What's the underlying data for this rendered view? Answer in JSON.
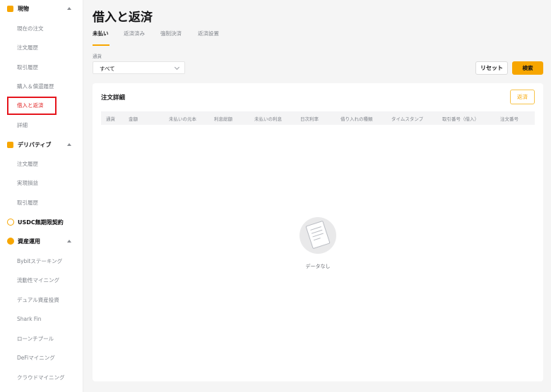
{
  "sidebar": {
    "sections": [
      {
        "label": "現物",
        "items": [
          "現在の注文",
          "注文履歴",
          "取引履歴",
          "購入＆償還履歴",
          "借入と返済",
          "詳細"
        ]
      },
      {
        "label": "デリバティブ",
        "items": [
          "注文履歴",
          "実現損益",
          "取引履歴"
        ]
      },
      {
        "label": "USDC無期限契約",
        "items": []
      },
      {
        "label": "資産運用",
        "items": [
          "Bybitステーキング",
          "流動性マイニング",
          "デュアル資産投資",
          "Shark Fin",
          "ローンチプール",
          "DeFiマイニング",
          "クラウドマイニング"
        ]
      }
    ],
    "active_item": "借入と返済"
  },
  "main": {
    "title": "借入と返済",
    "tabs": [
      "未払い",
      "返済済み",
      "強制決済",
      "返済設置"
    ],
    "active_tab": "未払い",
    "filter": {
      "currency_label": "通貨",
      "currency_value": "すべて"
    },
    "buttons": {
      "reset": "リセット",
      "search": "検索",
      "repay": "返済"
    },
    "card": {
      "title": "注文詳細",
      "columns": [
        "通貨",
        "金額",
        "未払いの元本",
        "利息総額",
        "未払いの利息",
        "日次利率",
        "借り入れの種類",
        "タイムスタンプ",
        "取引番号（借入）",
        "注文番号"
      ],
      "empty_text": "データなし"
    }
  },
  "colors": {
    "accent": "#f7a600",
    "active_nav": "#e02020",
    "highlight_box": "#e5141c"
  }
}
